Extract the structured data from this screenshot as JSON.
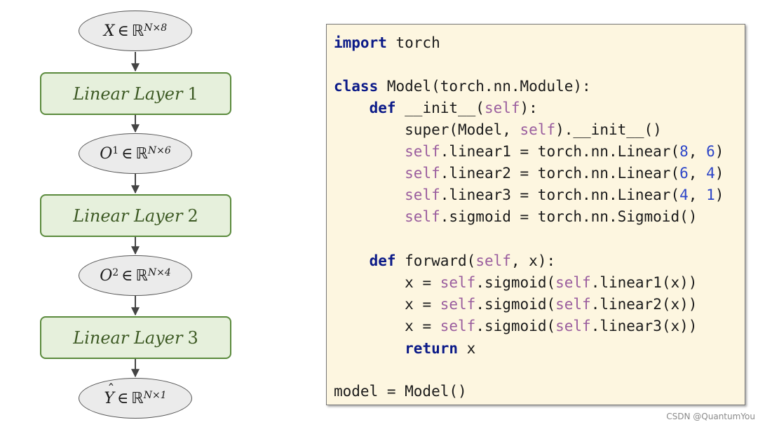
{
  "flowchart": {
    "input": {
      "symbol": "X",
      "relation": "∈",
      "set": "ℝ",
      "dims": "N×8"
    },
    "layer1": {
      "name": "Linear Layer",
      "index": "1"
    },
    "out1": {
      "symbol": "O",
      "superscript": "1",
      "relation": "∈",
      "set": "ℝ",
      "dims": "N×6"
    },
    "layer2": {
      "name": "Linear Layer",
      "index": "2"
    },
    "out2": {
      "symbol": "O",
      "superscript": "2",
      "relation": "∈",
      "set": "ℝ",
      "dims": "N×4"
    },
    "layer3": {
      "name": "Linear Layer",
      "index": "3"
    },
    "output": {
      "symbol": "Y",
      "relation": "∈",
      "set": "ℝ",
      "dims": "N×1"
    }
  },
  "code": {
    "l1": {
      "kw": "import",
      "rest": " torch"
    },
    "l2": {
      "kw": "class",
      "rest": " Model(torch.nn.Module):"
    },
    "l3": {
      "indent": "    ",
      "kw": "def",
      "name": " __init__(",
      "self": "self",
      "tail": "):"
    },
    "l4": {
      "indent": "        ",
      "pre": "super(Model, ",
      "self": "self",
      "tail": ").__init__()"
    },
    "l5": {
      "indent": "        ",
      "self": "self",
      "mid": ".linear1 = torch.nn.Linear(",
      "n1": "8",
      "sep": ", ",
      "n2": "6",
      "tail": ")"
    },
    "l6": {
      "indent": "        ",
      "self": "self",
      "mid": ".linear2 = torch.nn.Linear(",
      "n1": "6",
      "sep": ", ",
      "n2": "4",
      "tail": ")"
    },
    "l7": {
      "indent": "        ",
      "self": "self",
      "mid": ".linear3 = torch.nn.Linear(",
      "n1": "4",
      "sep": ", ",
      "n2": "1",
      "tail": ")"
    },
    "l8": {
      "indent": "        ",
      "self": "self",
      "tail": ".sigmoid = torch.nn.Sigmoid()"
    },
    "l9": {
      "indent": "    ",
      "kw": "def",
      "name": " forward(",
      "self": "self",
      "tail": ", x):"
    },
    "l10": {
      "indent": "        ",
      "pre": "x = ",
      "self": "self",
      "mid": ".sigmoid(",
      "self2": "self",
      "tail": ".linear1(x))"
    },
    "l11": {
      "indent": "        ",
      "pre": "x = ",
      "self": "self",
      "mid": ".sigmoid(",
      "self2": "self",
      "tail": ".linear2(x))"
    },
    "l12": {
      "indent": "        ",
      "pre": "x = ",
      "self": "self",
      "mid": ".sigmoid(",
      "self2": "self",
      "tail": ".linear3(x))"
    },
    "l13": {
      "indent": "        ",
      "kw": "return",
      "rest": " x"
    },
    "l14": {
      "rest": "model = Model()"
    }
  },
  "watermark": "CSDN @QuantumYou",
  "colors": {
    "keyword": "#0b1a88",
    "self": "#9a5d9e",
    "number": "#2c45c8",
    "layer_fill": "#e6f0dc",
    "layer_border": "#5a8a3c",
    "ellipse_fill": "#ebebeb",
    "code_bg": "#fdf6e0"
  }
}
